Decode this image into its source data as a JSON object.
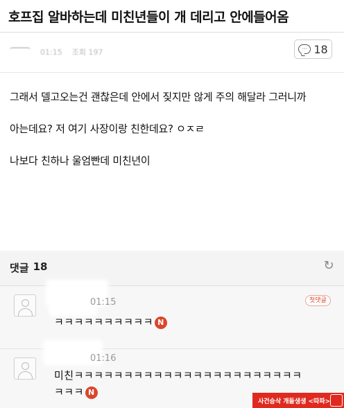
{
  "post": {
    "title": "호프집 알바하는데 미친년들이 개 데리고 안에들어옴",
    "meta_time": "01:15",
    "meta_views": "조회 197",
    "comment_count": "18",
    "body": [
      "그래서 델고오는건 괜찮은데 안에서 짖지만 않게 주의 해달라 그러니까",
      "아는데요? 저 여기 사장이랑 친한데요? ㅇㅈㄹ",
      "나보다 친하나 울엄빤데 미친년이"
    ]
  },
  "comments_header": {
    "label": "댓글",
    "count": "18",
    "refresh_icon": "refresh-icon"
  },
  "comments": [
    {
      "time": "01:15",
      "badge": "첫댓글",
      "text": "ㅋㅋㅋㅋㅋㅋㅋㅋㅋㅋ",
      "new_badge": "N"
    },
    {
      "time": "01:16",
      "text_line1": "미친ㅋㅋㅋㅋㅋㅋㅋㅋㅋㅋㅋㅋㅋㅋㅋㅋㅋㅋㅋㅋㅋㅋㅋ",
      "text_line2": "ㅋㅋㅋ",
      "new_badge": "N"
    }
  ],
  "watermark": {
    "text": "사건승삭 개들생생 <따파>"
  },
  "colors": {
    "accent_red": "#d9472b",
    "watermark_red": "#e02a1f"
  }
}
